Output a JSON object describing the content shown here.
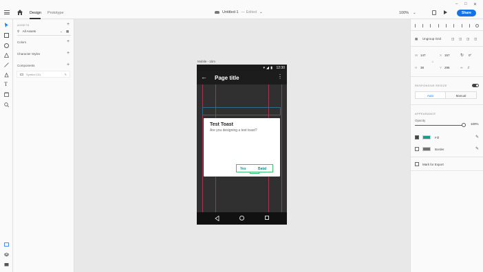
{
  "app": {
    "tabs": [
      "Design",
      "Prototype"
    ],
    "doc_title": "Untitled-1",
    "doc_status": "— Edited",
    "zoom": "100%",
    "share_label": "Share",
    "accent": "#1473e6"
  },
  "left_panel": {
    "assets_header": "ASSETS",
    "assets_filter": "All Assets",
    "colors_label": "Colors",
    "char_styles_label": "Character Styles",
    "components_label": "Components",
    "component_item": "Symbol 131"
  },
  "canvas": {
    "artboard_label": "Mobile - 1bm",
    "phone": {
      "status_time": "12:30",
      "page_title": "Page title",
      "dialog_title": "Test Toast",
      "dialog_message": "Are you designing a test toast?",
      "btn_yes": "Yes",
      "btn_batal": "Batal",
      "guide_color": "#c43a5a"
    }
  },
  "right_panel": {
    "ungroup_label": "Ungroup Grid",
    "w_label": "W",
    "w": "147",
    "x_label": "X",
    "x": "157",
    "rot": "0°",
    "h_label": "H",
    "h": "38",
    "y_label": "Y",
    "y": "296",
    "responsive_resize_header": "RESPONSIVE RESIZE",
    "auto_label": "Auto",
    "manual_label": "Manual",
    "appearance_header": "APPEARANCE",
    "opacity_label": "Opacity",
    "opacity_value": "100%",
    "fill_label": "Fill",
    "fill_color": "#1a9a8a",
    "border_label": "Border",
    "border_color": "#707070",
    "mark_export_label": "Mark for Export"
  }
}
